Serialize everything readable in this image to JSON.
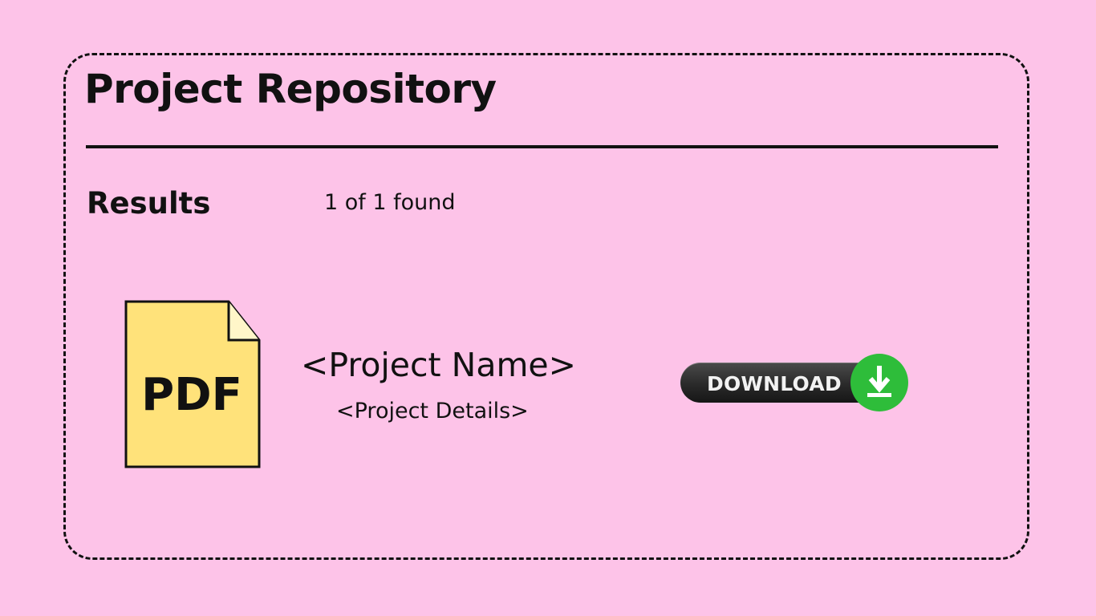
{
  "header": {
    "title": "Project Repository"
  },
  "results": {
    "heading": "Results",
    "count": "1 of 1 found"
  },
  "items": [
    {
      "file_type_label": "PDF",
      "file_icon": "pdf-file-icon",
      "name": "<Project Name>",
      "details": "<Project Details>",
      "download_label": "DOWNLOAD",
      "download_icon": "download-arrow-icon"
    }
  ],
  "colors": {
    "background": "#fdc3e8",
    "pdf_icon_fill": "#ffe27a",
    "download_button": "#2a2a2a",
    "download_accent": "#2ebd3a"
  }
}
